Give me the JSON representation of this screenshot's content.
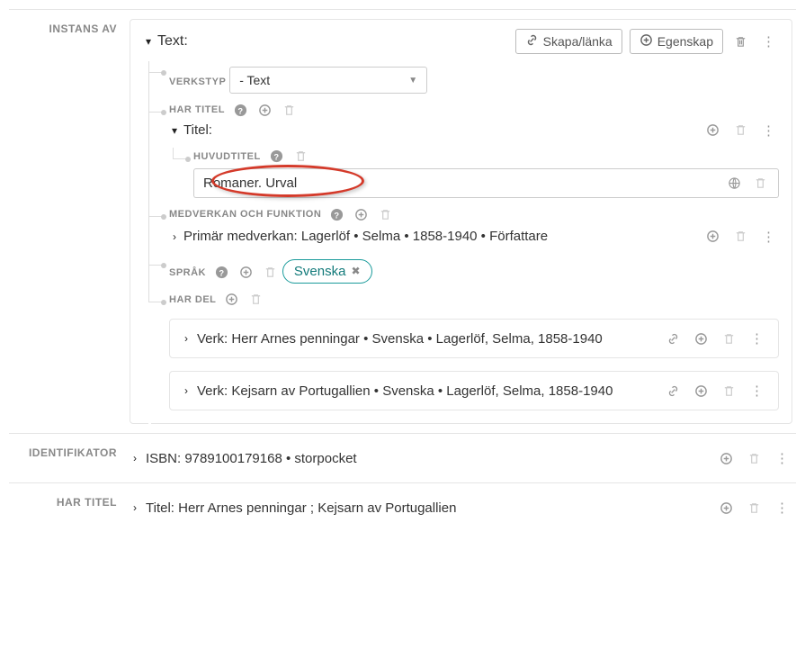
{
  "labels": {
    "instans_av": "INSTANS AV",
    "identifikator": "IDENTIFIKATOR",
    "har_titel_outer": "HAR TITEL"
  },
  "text_panel": {
    "title": "Text:",
    "skapa_lanka": "Skapa/länka",
    "egenskap": "Egenskap",
    "verkstyp": {
      "label": "VERKSTYP",
      "value": "- Text"
    },
    "har_titel": {
      "label": "HAR TITEL",
      "title": "Titel:",
      "huvudtitel_label": "HUVUDTITEL",
      "huvudtitel_value": "Romaner. Urval"
    },
    "medverkan": {
      "label": "MEDVERKAN OCH FUNKTION",
      "line": "Primär medverkan: Lagerlöf • Selma • 1858-1940 • Författare"
    },
    "sprak": {
      "label": "SPRÅK",
      "chip": "Svenska"
    },
    "har_del": {
      "label": "HAR DEL",
      "items": [
        "Verk: Herr Arnes penningar • Svenska • Lagerlöf, Selma, 1858-1940",
        "Verk: Kejsarn av Portugallien • Svenska • Lagerlöf, Selma, 1858-1940"
      ]
    }
  },
  "identifikator_line": "ISBN: 9789100179168 • storpocket",
  "har_titel_line": "Titel: Herr Arnes penningar ; Kejsarn av Portugallien"
}
